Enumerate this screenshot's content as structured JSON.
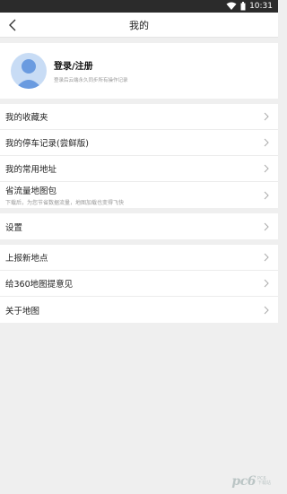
{
  "status_bar": {
    "time": "10:31"
  },
  "nav": {
    "title": "我的"
  },
  "profile": {
    "login_label": "登录/注册",
    "hint": "登录后云端永久同步所有操作记录"
  },
  "group1": {
    "items": [
      {
        "label": "我的收藏夹",
        "sub": ""
      },
      {
        "label": "我的停车记录(尝鲜版)",
        "sub": ""
      },
      {
        "label": "我的常用地址",
        "sub": ""
      },
      {
        "label": "省流量地图包",
        "sub": "下载后，为您节省数据流量，地图加载也变得飞快"
      }
    ]
  },
  "group2": {
    "items": [
      {
        "label": "设置"
      }
    ]
  },
  "group3": {
    "items": [
      {
        "label": "上报新地点"
      },
      {
        "label": "给360地图提意见"
      },
      {
        "label": "关于地图"
      }
    ]
  },
  "watermark": {
    "logo": "pc6",
    "line1": "PC6",
    "line2": "下载站"
  }
}
